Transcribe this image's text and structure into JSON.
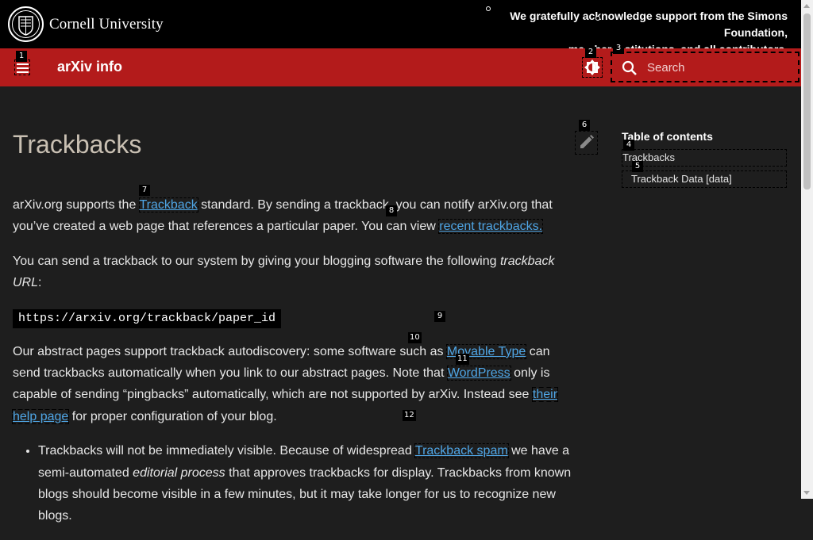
{
  "banner": {
    "university": "Cornell University",
    "ack_line1": "We gratefully acknowledge support from the Simons Foundation,",
    "ack_line2": "member institutions, and all contributors."
  },
  "header": {
    "site_title": "arXiv info",
    "search_placeholder": "Search"
  },
  "page": {
    "title": "Trackbacks"
  },
  "article": {
    "p1_a": "arXiv.org supports the ",
    "p1_link1": "Trackback",
    "p1_b": " standard. By sending a trackback, you can notify arXiv.org that you’ve created a web page that references a particular paper. You can view ",
    "p1_link2": "recent trackbacks.",
    "p2_a": "You can send a trackback to our system by giving your blogging software the following ",
    "p2_em": "trackback URL",
    "p2_b": ":",
    "code": "https://arxiv.org/trackback/paper_id",
    "p3_a": "Our abstract pages support trackback autodiscovery: some software such as ",
    "p3_link1": "Movable Type",
    "p3_b": " can send trackbacks automatically when you link to our abstract pages. Note that ",
    "p3_link2": "WordPress",
    "p3_c": " only is capable of sending “pingbacks” automatically, which are not supported by arXiv. Instead see ",
    "p3_link3": "their help page",
    "p3_d": " for proper configuration of your blog.",
    "li1_a": "Trackbacks will not be immediately visible. Because of widespread ",
    "li1_link": "Trackback spam",
    "li1_b": " we have a semi-automated ",
    "li1_em": "editorial process",
    "li1_c": " that approves trackbacks for display. Trackbacks from known blogs should become visible in a few minutes, but it may take longer for us to recognize new blogs."
  },
  "toc": {
    "heading": "Table of contents",
    "items": [
      "Trackbacks",
      "Trackback Data [data]"
    ]
  },
  "tags": [
    "1",
    "2",
    "3",
    "4",
    "5",
    "6",
    "7",
    "8",
    "9",
    "10",
    "11",
    "12"
  ]
}
